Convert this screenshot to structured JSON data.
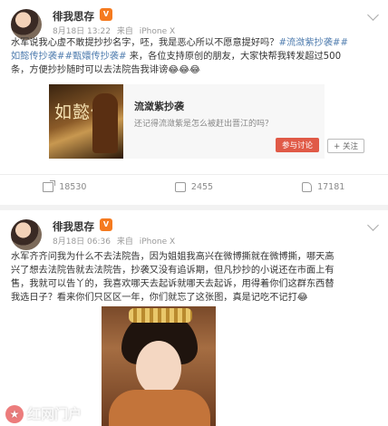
{
  "posts": [
    {
      "username": "徘我思存",
      "vip_badge": "V",
      "date": "8月18日 13:22",
      "source_prefix": "来自",
      "source": "iPhone X",
      "text_lines": [
        [
          "水军说我心虚不敢提抄抄名字，呸，我是恶心所以不愿意提好吗？",
          "#流潋紫抄袭##"
        ],
        [
          "如懿传抄袭##甄嬛传抄袭#",
          " 来，各位支持原创的朋友，大家快帮我转发超过500"
        ],
        [
          "条，方便抄抄随时可以去法院告我诽谤",
          "😂😂😂"
        ]
      ],
      "share": {
        "image_title": "如懿传",
        "title": "流潋紫抄袭",
        "desc": "还记得流潋紫是怎么被赶出晋江的吗？",
        "join_button": "参与讨论",
        "follow_button": "+ 关注"
      },
      "actions": {
        "reposts": "18530",
        "comments": "2455",
        "likes": "17181"
      }
    },
    {
      "username": "徘我思存",
      "vip_badge": "V",
      "date": "8月18日 06:36",
      "source_prefix": "来自",
      "source": "iPhone X",
      "text_lines": [
        "水军齐齐问我为什么不去法院告，因为姐姐我高兴在微博撕就在微博撕，哪天高",
        "兴了想去法院告就去法院告，抄袭又没有追诉期，但凡抄抄的小说还在市面上有",
        "售，我就可以告丫的，我喜欢哪天去起诉就哪天去起诉，用得着你们这群东西替",
        "我选日子？看来你们只区区一年，你们就忘了这张图，真是记吃不记打😂"
      ],
      "watermark": "红网门户"
    }
  ]
}
